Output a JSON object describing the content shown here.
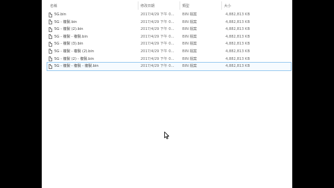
{
  "columns": {
    "name": "名稱",
    "date": "修改日期",
    "type": "類型",
    "size": "大小"
  },
  "files": [
    {
      "name": "5G.bin",
      "date": "2017/4/29 下午 0...",
      "type": "BIN 檔案",
      "size": "4,882,813 KB"
    },
    {
      "name": "5G - 複製.bin",
      "date": "2017/4/29 下午 0...",
      "type": "BIN 檔案",
      "size": "4,882,813 KB"
    },
    {
      "name": "5G - 複製 (2).bin",
      "date": "2017/4/29 下午 0...",
      "type": "BIN 檔案",
      "size": "4,882,813 KB"
    },
    {
      "name": "5G - 複製 - 複製.bin",
      "date": "2017/4/29 下午 0...",
      "type": "BIN 檔案",
      "size": "4,882,813 KB"
    },
    {
      "name": "5G - 複製 (3).bin",
      "date": "2017/4/29 下午 0...",
      "type": "BIN 檔案",
      "size": "4,882,813 KB"
    },
    {
      "name": "5G - 複製 - 複製 (2).bin",
      "date": "2017/4/29 下午 0...",
      "type": "BIN 檔案",
      "size": "4,882,813 KB"
    },
    {
      "name": "5G - 複製 (2) - 複製.bin",
      "date": "2017/4/29 下午 0...",
      "type": "BIN 檔案",
      "size": "4,882,813 KB"
    },
    {
      "name": "5G - 複製 - 複製 - 複製.bin",
      "date": "2017/4/29 下午 0...",
      "type": "BIN 檔案",
      "size": "4,882,813 KB"
    }
  ],
  "selected_index": 7
}
